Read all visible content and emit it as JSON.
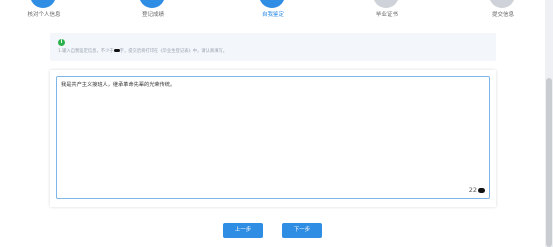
{
  "steps": [
    {
      "label": "核对个人信息",
      "state": "done"
    },
    {
      "label": "登记成绩",
      "state": "done"
    },
    {
      "label": "自我鉴定",
      "state": "active"
    },
    {
      "label": "毕业证书",
      "state": "pending"
    },
    {
      "label": "提交信息",
      "state": "pending"
    }
  ],
  "notice": {
    "icon": "i",
    "text_before": "1.输入自我鉴定信息，不少于",
    "text_after": "字，提交后将打印在《毕业生登记表》中，请认真填写。"
  },
  "editor": {
    "value": "我是共产主义接班人，继承革命先辈的光荣传统。",
    "counter": "22"
  },
  "buttons": {
    "prev": "上一步",
    "next": "下一步"
  },
  "colors": {
    "primary": "#2f8de4",
    "notice_bg": "#f3f6fb",
    "success": "#2fb24c"
  }
}
